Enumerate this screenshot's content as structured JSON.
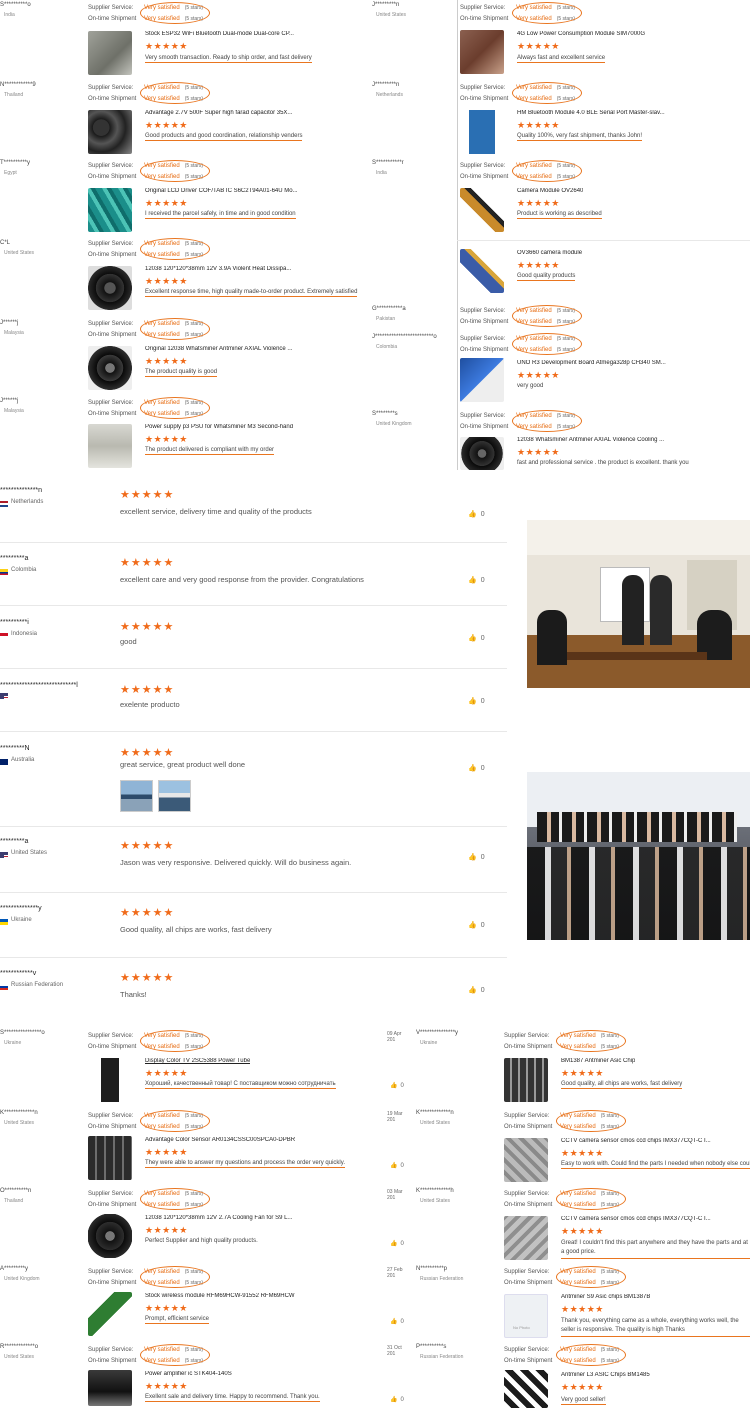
{
  "top_reviews": {
    "left": [
      {
        "buyer": "S**********o",
        "country": "India",
        "service": "Very satisfied",
        "shipment": "Very satisfied",
        "stars_note": "(5 stars)",
        "product": "Stock ESP32 WiFi Bluetooth Dual-mode Dual-core CP...",
        "rating": "★★★★★",
        "comment": "Very smooth transaction. Ready to ship order, and fast delivery"
      },
      {
        "buyer": "N************9",
        "country": "Thailand",
        "service": "Very satisfied",
        "shipment": "Very satisfied",
        "stars_note": "(5 stars)",
        "product": "Advantage 2.7V 500F Super high farad capacitor 35X...",
        "rating": "★★★★★",
        "comment": "Good products and good coordination, relationship venders"
      },
      {
        "buyer": "T**********y",
        "country": "Egypt",
        "service": "Very satisfied",
        "shipment": "Very satisfied",
        "stars_note": "(5 stars)",
        "product": "Original LCD Driver COF/TAB IC S6C2T94A01-64U Mo...",
        "rating": "★★★★★",
        "comment": "I received the parcel safely, in time and in good condition"
      },
      {
        "buyer": "C*L",
        "country": "United States",
        "service": "Very satisfied",
        "shipment": "Very satisfied",
        "stars_note": "(5 stars)",
        "product": "12038 120*120*38mm 12V 3.9A Violent Heat Dissipa...",
        "rating": "★★★★★",
        "comment": "Excellent response time, high quality made-to-order product. Extremely satisfied"
      },
      {
        "buyer": "J******j",
        "country": "Malaysia",
        "service": "Very satisfied",
        "shipment": "Very satisfied",
        "stars_note": "(5 stars)",
        "product": "Original 12038 Whatsminer Antminer AXIAL Violence ...",
        "rating": "★★★★★",
        "comment": "The product quality is good"
      },
      {
        "buyer": "J******j",
        "country": "Malaysia",
        "service": "Very satisfied",
        "shipment": "Very satisfied",
        "stars_note": "(5 stars)",
        "product": "Power supply p3 PSU for Whatsminer M3 Second-hand",
        "rating": "★★★★★",
        "comment": "The product delivered is compliant with my order"
      }
    ],
    "right": [
      {
        "buyer": "J*********n",
        "country": "United States",
        "service": "Very satisfied",
        "shipment": "Very satisfied",
        "stars_note": "(5 stars)",
        "product": "4G Low Power Consumption Module SIM7000G",
        "rating": "★★★★★",
        "comment": "Always fast and excellent service"
      },
      {
        "buyer": "J*********n",
        "country": "Netherlands",
        "service": "Very satisfied",
        "shipment": "Very satisfied",
        "stars_note": "(5 stars)",
        "product": "HM Bluetooth Module 4.0 BLE Serial Port Master-slav...",
        "rating": "★★★★★",
        "comment": "Quality 100%, very fast shipment, thanks John!"
      },
      {
        "buyer": "S***********r",
        "country": "India",
        "service": "Very satisfied",
        "shipment": "Very satisfied",
        "stars_note": "(5 stars)",
        "product": "Camera Module OV2640",
        "rating": "★★★★★",
        "comment": "Product is working as described"
      },
      {
        "buyer": "",
        "country": "",
        "service": "",
        "shipment": "",
        "stars_note": "",
        "product": "OV3660 camera module",
        "rating": "★★★★★",
        "comment": "Good quality products"
      },
      {
        "buyer": "G***********a",
        "country": "Pakistan",
        "service": "Very satisfied",
        "shipment": "Very satisfied",
        "stars_note": "(5 stars)",
        "product": "",
        "rating": "",
        "comment": ""
      },
      {
        "buyer": "J*************************o",
        "country": "Colombia",
        "service": "Very satisfied",
        "shipment": "Very satisfied",
        "stars_note": "(5 stars)",
        "product": "UNO R3 Development Board Atmega328p CH340 SM...",
        "rating": "★★★★★",
        "comment": "very good"
      },
      {
        "buyer": "S********s",
        "country": "United Kingdom",
        "service": "Very satisfied",
        "shipment": "Very satisfied",
        "stars_note": "(5 stars)",
        "product": "12038 Whatsminer Antminer AXIAL Violence Cooling ...",
        "rating": "★★★★★",
        "comment": "fast and professional service . the product is excellent. thank you"
      }
    ],
    "labels": {
      "service": "Supplier Service:",
      "shipment": "On-time Shipment"
    }
  },
  "mid_reviews": [
    {
      "name": "**************n",
      "country": "Netherlands",
      "rating": "★★★★★",
      "text": "excellent service, delivery time and quality of the products",
      "likes": "0"
    },
    {
      "name": "*********a",
      "country": "Colombia",
      "rating": "★★★★★",
      "text": "excellent care and very good response from the provider. Congratulations",
      "likes": "0"
    },
    {
      "name": "**********i",
      "country": "Indonesia",
      "rating": "★★★★★",
      "text": "good",
      "likes": "0"
    },
    {
      "name": "****************************l",
      "country": "",
      "rating": "★★★★★",
      "text": "exelente producto",
      "likes": "0"
    },
    {
      "name": "*********N",
      "country": "Australia",
      "rating": "★★★★★",
      "text": "great service, great product well done",
      "likes": "0"
    },
    {
      "name": "*********a",
      "country": "United States",
      "rating": "★★★★★",
      "text": "Jason was very responsive. Delivered quickly. Will do business again.",
      "likes": "0"
    },
    {
      "name": "**************y",
      "country": "Ukraine",
      "rating": "★★★★★",
      "text": "Good quality, all chips are works, fast delivery",
      "likes": "0"
    },
    {
      "name": "************v",
      "country": "Russian Federation",
      "rating": "★★★★★",
      "text": "Thanks!",
      "likes": "0"
    }
  ],
  "bottom_reviews": {
    "left": [
      {
        "buyer": "S****************o",
        "country": "Ukraine",
        "service": "Very satisfied",
        "shipment": "Very satisfied",
        "stars_note": "(5 stars)",
        "product": "Display Color TV 2SC5388 Power Tube",
        "rating": "★★★★★",
        "comment": "Хороший, качественный товар! С поставщиком можно сотрудничать",
        "date": "09 Apr 201",
        "likes": "0"
      },
      {
        "buyer": "K*************n",
        "country": "United States",
        "service": "Very satisfied",
        "shipment": "Very satisfied",
        "stars_note": "(5 stars)",
        "product": "Advantage Color Sensor AR0134CSSC00SPCA0-DPBR",
        "rating": "★★★★★",
        "comment": "They were able to answer my questions and process the order very quickly.",
        "date": "19 Mar 201",
        "likes": "0"
      },
      {
        "buyer": "O**********n",
        "country": "Thailand",
        "service": "Very satisfied",
        "shipment": "Very satisfied",
        "stars_note": "(5 stars)",
        "product": "12038 120*120*38mm 12V 2.7A Cooling Fan for S9 L...",
        "rating": "★★★★★",
        "comment": "Perfect Supplier and high quality products.",
        "date": "03 Mar 201",
        "likes": "0"
      },
      {
        "buyer": "A*********y",
        "country": "United Kingdom",
        "service": "Very satisfied",
        "shipment": "Very satisfied",
        "stars_note": "(5 stars)",
        "product": "Stock wireless module RFM69HCW-91552 RFM69HCW",
        "rating": "★★★★★",
        "comment": "Prompt, efficient service",
        "date": "27 Feb 201",
        "likes": "0"
      },
      {
        "buyer": "R*************o",
        "country": "United States",
        "service": "Very satisfied",
        "shipment": "Very satisfied",
        "stars_note": "(5 stars)",
        "product": "Power amplifier ic STK404-140S",
        "rating": "★★★★★",
        "comment": "Exellent sale and delivery time. Happy to recommend. Thank you.",
        "date": "31 Oct 201",
        "likes": "0"
      }
    ],
    "right": [
      {
        "buyer": "V***************y",
        "country": "Ukraine",
        "service": "Very satisfied",
        "shipment": "Very satisfied",
        "stars_note": "(5 stars)",
        "product": "BM1387 Antminer Asic Chip",
        "rating": "★★★★★",
        "comment": "Good quality, all chips are works, fast delivery"
      },
      {
        "buyer": "K*************n",
        "country": "United States",
        "service": "Very satisfied",
        "shipment": "Very satisfied",
        "stars_note": "(5 stars)",
        "product": "CCTV camera sensor cmos ccd chips IMX377CQT-C I...",
        "rating": "★★★★★",
        "comment": "Easy to work with.  Could find the parts I needed when nobody else could."
      },
      {
        "buyer": "K*************h",
        "country": "United States",
        "service": "Very satisfied",
        "shipment": "Very satisfied",
        "stars_note": "(5 stars)",
        "product": "CCTV camera sensor cmos ccd chips IMX377CQT-C I...",
        "rating": "★★★★★",
        "comment": "Great!  I couldn't find this part anywhere and they have the parts and at a good price."
      },
      {
        "buyer": "N**********p",
        "country": "Russian Federation",
        "service": "Very satisfied",
        "shipment": "Very satisfied",
        "stars_note": "(5 stars)",
        "product": "Antminer S9 Asic chips BM1387B",
        "rating": "★★★★★",
        "comment": "Thank you, everything came as a whole, everything works well, the seller is responsive. The quality is high Thanks"
      },
      {
        "buyer": "P**********s",
        "country": "Russian Federation",
        "service": "Very satisfied",
        "shipment": "Very satisfied",
        "stars_note": "(5 stars)",
        "product": "Antminer L3 ASIC Chips BM1485",
        "rating": "★★★★★",
        "comment": "Very good seller!"
      }
    ],
    "no_photo": "No Photo"
  },
  "colors": {
    "accent": "#f06b1a",
    "oval": "#e9751f"
  }
}
